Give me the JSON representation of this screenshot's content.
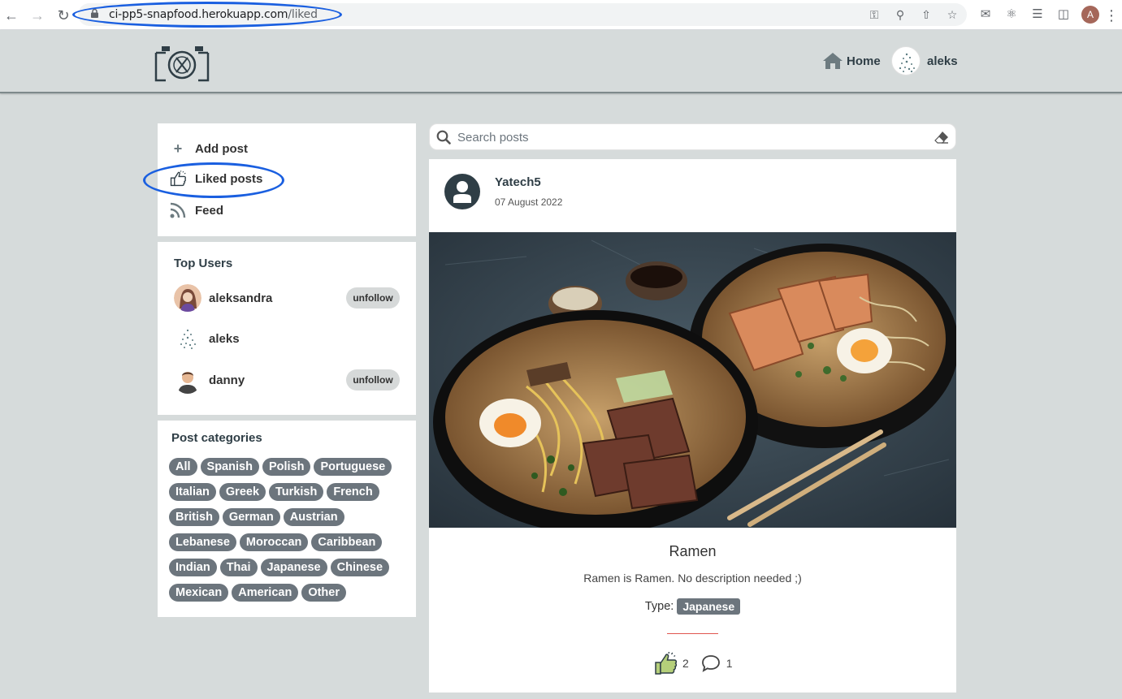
{
  "browser": {
    "url_host": "ci-pp5-snapfood.herokuapp.com",
    "url_path": "/liked",
    "profile_initial": "A"
  },
  "header": {
    "home_label": "Home",
    "username": "aleks"
  },
  "side_nav": {
    "items": [
      {
        "label": "Add post",
        "icon": "plus-icon"
      },
      {
        "label": "Liked posts",
        "icon": "thumbs-up-icon"
      },
      {
        "label": "Feed",
        "icon": "rss-feed-icon"
      }
    ]
  },
  "top_users": {
    "title": "Top Users",
    "users": [
      {
        "name": "aleksandra",
        "action": "unfollow"
      },
      {
        "name": "aleks",
        "action": ""
      },
      {
        "name": "danny",
        "action": "unfollow"
      }
    ]
  },
  "categories": {
    "title": "Post categories",
    "items": [
      "All",
      "Spanish",
      "Polish",
      "Portuguese",
      "Italian",
      "Greek",
      "Turkish",
      "French",
      "British",
      "German",
      "Austrian",
      "Lebanese",
      "Moroccan",
      "Caribbean",
      "Indian",
      "Thai",
      "Japanese",
      "Chinese",
      "Mexican",
      "American",
      "Other"
    ]
  },
  "search": {
    "placeholder": "Search posts",
    "value": ""
  },
  "post": {
    "author": "Yatech5",
    "date": "07 August 2022",
    "title": "Ramen",
    "description": "Ramen is Ramen. No description needed ;)",
    "type_label": "Type:",
    "type_value": "Japanese",
    "likes": "2",
    "comments": "1"
  },
  "colors": {
    "page_bg": "#d6dbdb",
    "pill_bg": "#6c757d",
    "annotation": "#1a5fe0",
    "divider": "#e0554f"
  }
}
